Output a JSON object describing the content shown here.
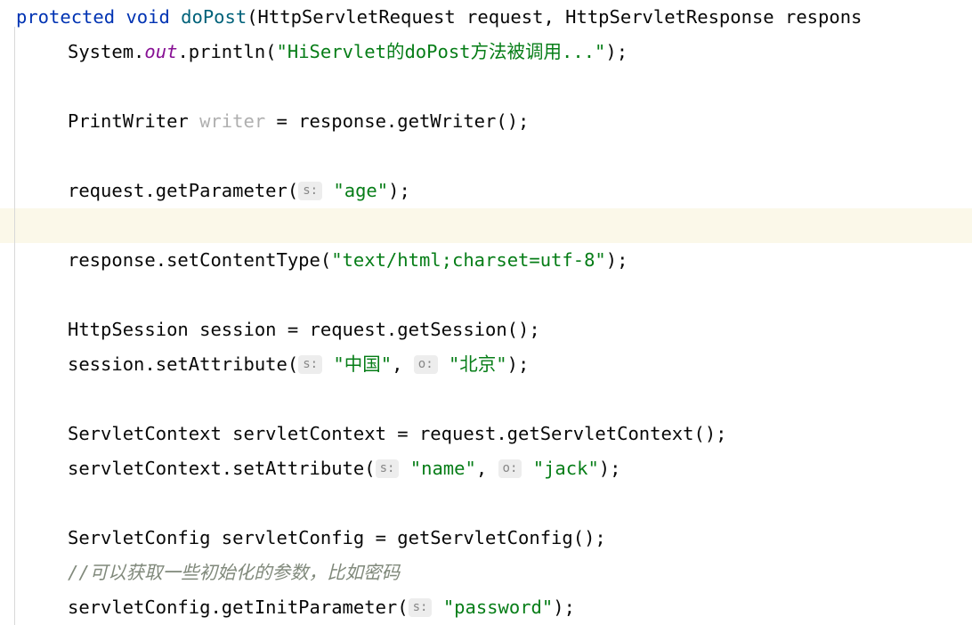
{
  "editor": {
    "language": "Java",
    "theme": "IntelliJ Light",
    "colors": {
      "background": "#FFFFFF",
      "foreground": "#080808",
      "keyword": "#0033B3",
      "method_declaration": "#00627A",
      "string": "#067D17",
      "static_field": "#871094",
      "comment": "#80897B",
      "unused_identifier": "#AFAFAF",
      "caret_row": "#FBF8E9",
      "indent_guide": "#D8D8D8",
      "hint_chip_background": "#EDEDED",
      "hint_chip_text": "#878787"
    },
    "caret_line_index": 6,
    "lines": [
      {
        "index": 0,
        "indent": 0,
        "truncated_right": true,
        "tokens": [
          {
            "text": "protected",
            "style": "kw"
          },
          {
            "text": " ",
            "style": "plain"
          },
          {
            "text": "void",
            "style": "kw"
          },
          {
            "text": " ",
            "style": "plain"
          },
          {
            "text": "doPost",
            "style": "method"
          },
          {
            "text": "(HttpServletRequest request, HttpServletResponse respons",
            "style": "plain"
          }
        ]
      },
      {
        "index": 1,
        "indent": 1,
        "tokens": [
          {
            "text": "System.",
            "style": "plain"
          },
          {
            "text": "out",
            "style": "field"
          },
          {
            "text": ".println(",
            "style": "plain"
          },
          {
            "text": "\"HiServlet的doPost方法被调用...\"",
            "style": "str"
          },
          {
            "text": ");",
            "style": "plain"
          }
        ]
      },
      {
        "index": 2,
        "indent": 1,
        "tokens": []
      },
      {
        "index": 3,
        "indent": 1,
        "tokens": [
          {
            "text": "PrintWriter ",
            "style": "plain"
          },
          {
            "text": "writer",
            "style": "unused"
          },
          {
            "text": " = response.getWriter();",
            "style": "plain"
          }
        ]
      },
      {
        "index": 4,
        "indent": 1,
        "tokens": []
      },
      {
        "index": 5,
        "indent": 1,
        "tokens": [
          {
            "text": "request.getParameter(",
            "style": "plain"
          },
          {
            "text": "s:",
            "style": "hint"
          },
          {
            "text": " ",
            "style": "plain"
          },
          {
            "text": "\"age\"",
            "style": "str"
          },
          {
            "text": ");",
            "style": "plain"
          }
        ]
      },
      {
        "index": 6,
        "indent": 1,
        "tokens": []
      },
      {
        "index": 7,
        "indent": 1,
        "tokens": [
          {
            "text": "response.setContentType(",
            "style": "plain"
          },
          {
            "text": "\"text/html;charset=utf-8\"",
            "style": "str"
          },
          {
            "text": ");",
            "style": "plain"
          }
        ]
      },
      {
        "index": 8,
        "indent": 1,
        "tokens": []
      },
      {
        "index": 9,
        "indent": 1,
        "tokens": [
          {
            "text": "HttpSession session = request.getSession();",
            "style": "plain"
          }
        ]
      },
      {
        "index": 10,
        "indent": 1,
        "tokens": [
          {
            "text": "session.setAttribute(",
            "style": "plain"
          },
          {
            "text": "s:",
            "style": "hint"
          },
          {
            "text": " ",
            "style": "plain"
          },
          {
            "text": "\"中国\"",
            "style": "str"
          },
          {
            "text": ", ",
            "style": "plain"
          },
          {
            "text": "o:",
            "style": "hint"
          },
          {
            "text": " ",
            "style": "plain"
          },
          {
            "text": "\"北京\"",
            "style": "str"
          },
          {
            "text": ");",
            "style": "plain"
          }
        ]
      },
      {
        "index": 11,
        "indent": 1,
        "tokens": []
      },
      {
        "index": 12,
        "indent": 1,
        "tokens": [
          {
            "text": "ServletContext servletContext = request.getServletContext();",
            "style": "plain"
          }
        ]
      },
      {
        "index": 13,
        "indent": 1,
        "tokens": [
          {
            "text": "servletContext.setAttribute(",
            "style": "plain"
          },
          {
            "text": "s:",
            "style": "hint"
          },
          {
            "text": " ",
            "style": "plain"
          },
          {
            "text": "\"name\"",
            "style": "str"
          },
          {
            "text": ", ",
            "style": "plain"
          },
          {
            "text": "o:",
            "style": "hint"
          },
          {
            "text": " ",
            "style": "plain"
          },
          {
            "text": "\"jack\"",
            "style": "str"
          },
          {
            "text": ");",
            "style": "plain"
          }
        ]
      },
      {
        "index": 14,
        "indent": 1,
        "tokens": []
      },
      {
        "index": 15,
        "indent": 1,
        "tokens": [
          {
            "text": "ServletConfig servletConfig = getServletConfig();",
            "style": "plain"
          }
        ]
      },
      {
        "index": 16,
        "indent": 1,
        "tokens": [
          {
            "text": "//可以获取一些初始化的参数，比如密码",
            "style": "comment"
          }
        ]
      },
      {
        "index": 17,
        "indent": 1,
        "tokens": [
          {
            "text": "servletConfig.getInitParameter(",
            "style": "plain"
          },
          {
            "text": "s:",
            "style": "hint"
          },
          {
            "text": " ",
            "style": "plain"
          },
          {
            "text": "\"password\"",
            "style": "str"
          },
          {
            "text": ");",
            "style": "plain"
          }
        ]
      }
    ]
  }
}
